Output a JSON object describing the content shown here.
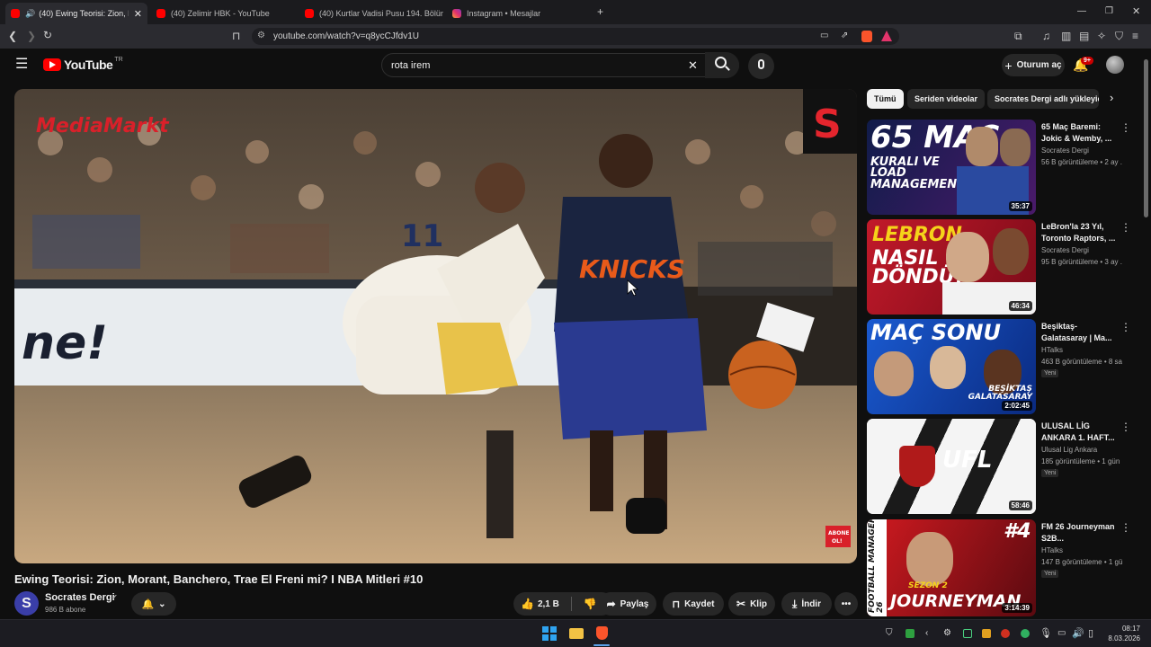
{
  "browser": {
    "tabs": [
      {
        "title": "(40) Ewing Teorisi: Zion, Mora",
        "active": true,
        "icon": "youtube-favicon"
      },
      {
        "title": "(40) Zelimir HBK - YouTube",
        "active": false,
        "icon": "youtube-favicon"
      },
      {
        "title": "(40) Kurtlar Vadisi Pusu 194. Bölüm ·",
        "active": false,
        "icon": "youtube-favicon"
      },
      {
        "title": "Instagram • Mesajlar",
        "active": false,
        "icon": "instagram-favicon"
      }
    ],
    "url": "youtube.com/watch?v=q8ycCJfdv1U"
  },
  "youtube": {
    "logo": "YouTube",
    "logo_region": "TR",
    "search_value": "rota irem",
    "signin_label": "Oturum aç",
    "notifications": "9+"
  },
  "video": {
    "title": "Ewing Teorisi: Zion, Morant, Banchero, Trae El Freni mi? I NBA Mitleri #10",
    "channel": "Socrates Dergi",
    "channel_initial": "S",
    "subscribers": "986 B abone",
    "likes": "2,1 B",
    "share_label": "Paylaş",
    "save_label": "Kaydet",
    "clip_label": "Klip",
    "download_label": "İndir",
    "overlay_brand": "MediaMarkt",
    "overlay_logo": "S",
    "subscribe_badge": "ABONE OL!",
    "jersey_number": "11",
    "sponsor_text": "ne!"
  },
  "sidebar": {
    "chips": [
      "Tümü",
      "Seriden videolar",
      "Socrates Dergi adlı yükleyici"
    ],
    "recommendations": [
      {
        "title": "65 Maç Baremi: Jokic & Wemby, ...",
        "channel": "Socrates Dergi",
        "meta": "56 B görüntüleme • 2 ay ...",
        "duration": "35:37",
        "new": "",
        "thumb_text": "65 MAÇ",
        "thumb_sub": "KURALI VE LOAD MANAGEMENT"
      },
      {
        "title": "LeBron'la 23 Yıl, Toronto Raptors, ...",
        "channel": "Socrates Dergi",
        "meta": "95 B görüntüleme • 3 ay ...",
        "duration": "46:34",
        "new": "",
        "thumb_text": "LEBRON",
        "thumb_sub": "NASIL DÖNDÜ?"
      },
      {
        "title": "Beşiktaş-Galatasaray | Ma...",
        "channel": "HTalks",
        "meta": "463 B görüntüleme • 8 sa...",
        "duration": "2:02:45",
        "new": "Yeni",
        "thumb_text": "MAÇ SONU",
        "thumb_sub": "BEŞİKTAŞ GALATASARAY"
      },
      {
        "title": "ULUSAL LİG ANKARA 1. HAFT...",
        "channel": "Ulusal Lig Ankara",
        "meta": "185 görüntüleme • 1 gün ...",
        "duration": "58:46",
        "new": "Yeni",
        "thumb_text": "UFL",
        "thumb_sub": ""
      },
      {
        "title": "FM 26 Journeyman S2B...",
        "channel": "HTalks",
        "meta": "147 B görüntüleme • 1 gü...",
        "duration": "3:14:39",
        "new": "Yeni",
        "thumb_text": "JOURNEYMAN",
        "thumb_sub": "SEZON 2"
      }
    ],
    "fm_badge": "FOOTBALL MANAGER 26",
    "ep_badge": "#4"
  },
  "taskbar": {
    "time": "08:17",
    "date": "8.03.2026"
  },
  "colors": {
    "youtube_red": "#ff0000",
    "background": "#0f0f0f",
    "chip": "#272727"
  }
}
